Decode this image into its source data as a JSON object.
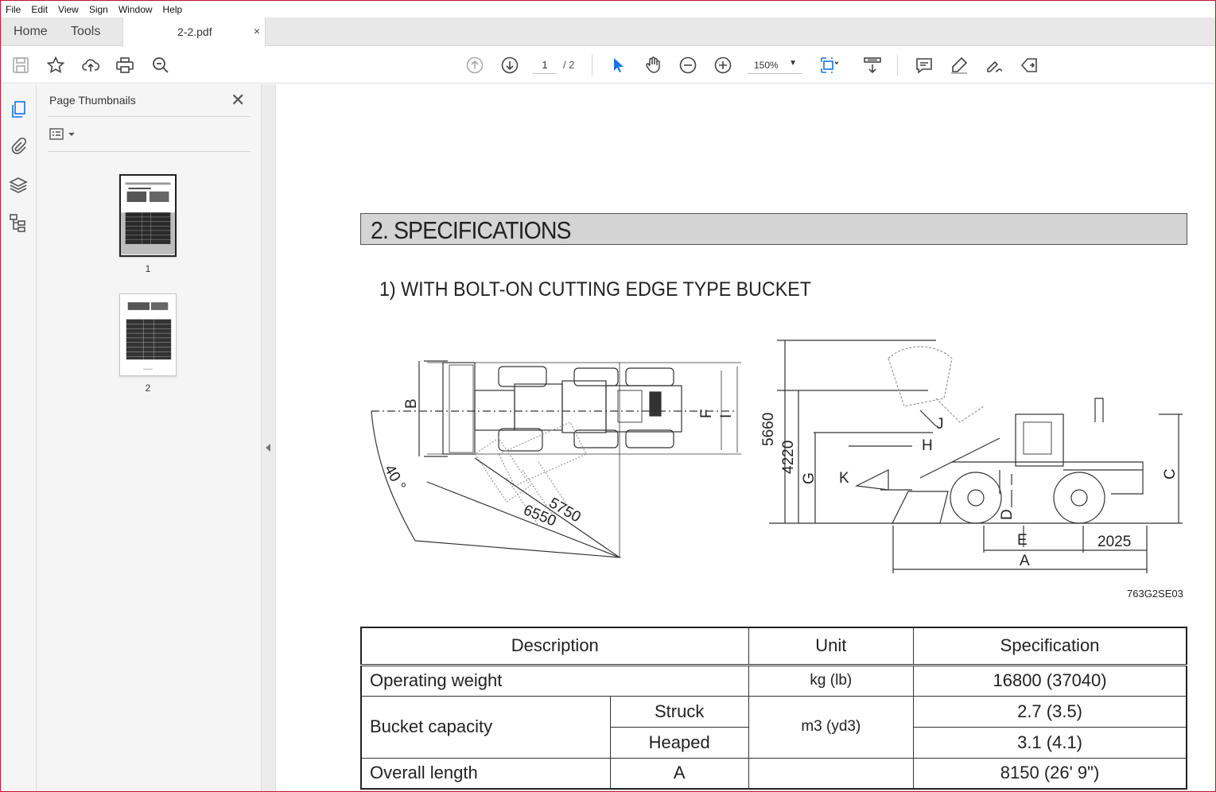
{
  "menu": [
    "File",
    "Edit",
    "View",
    "Sign",
    "Window",
    "Help"
  ],
  "tabs": {
    "home": "Home",
    "tools": "Tools",
    "document": "2-2.pdf",
    "close_glyph": "×"
  },
  "toolbar": {
    "page_current": "1",
    "page_total": "/ 2",
    "zoom": "150%"
  },
  "thumbnails": {
    "title": "Page Thumbnails",
    "close_glyph": "✕",
    "pages": [
      {
        "label": "1"
      },
      {
        "label": "2"
      }
    ]
  },
  "document": {
    "section_title": "2. SPECIFICATIONS",
    "subheading": "1) WITH BOLT-ON CUTTING EDGE TYPE BUCKET",
    "figure_code": "763G2SE03",
    "figure_labels": {
      "B": "B",
      "F": "F",
      "I": "I",
      "angle": "40 °",
      "r1": "5750",
      "r2": "6550",
      "h1": "5660",
      "h2": "4220",
      "G": "G",
      "H": "H",
      "J": "J",
      "K": "K",
      "C": "C",
      "D": "D",
      "E": "E",
      "A": "A",
      "wb": "2025"
    },
    "table": {
      "headers": [
        "Description",
        "Unit",
        "Specification"
      ],
      "rows": {
        "op_weight": {
          "desc": "Operating weight",
          "unit": "kg (lb)",
          "spec": "16800 (37040)"
        },
        "bucket": {
          "desc": "Bucket capacity",
          "unit": "m3 (yd3)",
          "struck": {
            "label": "Struck",
            "spec": "2.7 (3.5)"
          },
          "heaped": {
            "label": "Heaped",
            "spec": "3.1 (4.1)"
          }
        },
        "length": {
          "desc": "Overall length",
          "sub": "A",
          "unit": "",
          "spec": "8150 (26' 9\")"
        }
      }
    }
  }
}
